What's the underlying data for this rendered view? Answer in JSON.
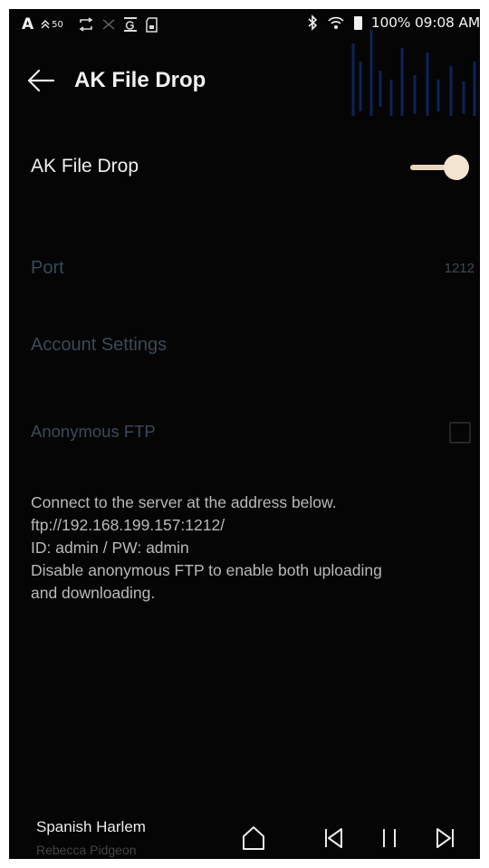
{
  "status_bar": {
    "indicator_letter": "A",
    "signal_value": "50",
    "battery_time": "100% 09:08 AM",
    "icons": [
      "repeat-icon",
      "shuffle-icon",
      "eq-icon",
      "sd-card-icon",
      "bluetooth-icon",
      "wifi-icon",
      "battery-icon"
    ]
  },
  "header": {
    "title": "AK File Drop"
  },
  "settings": {
    "toggle_label": "AK File Drop",
    "toggle_on": true,
    "port_label": "Port",
    "port_value": "1212",
    "account_label": "Account Settings",
    "anonymous_label": "Anonymous FTP",
    "anonymous_checked": false
  },
  "info": {
    "line1": "Connect to the server at the address below.",
    "line2": "ftp://192.168.199.157:1212/",
    "line3": "ID: admin / PW: admin",
    "line4": "Disable anonymous FTP to enable both uploading",
    "line5": "and downloading."
  },
  "player": {
    "title": "Spanish Harlem",
    "artist": "Rebecca Pidgeon"
  },
  "colors": {
    "background": "#050505",
    "accent": "#f2e4cf",
    "dim_text": "#3a4a5a"
  }
}
